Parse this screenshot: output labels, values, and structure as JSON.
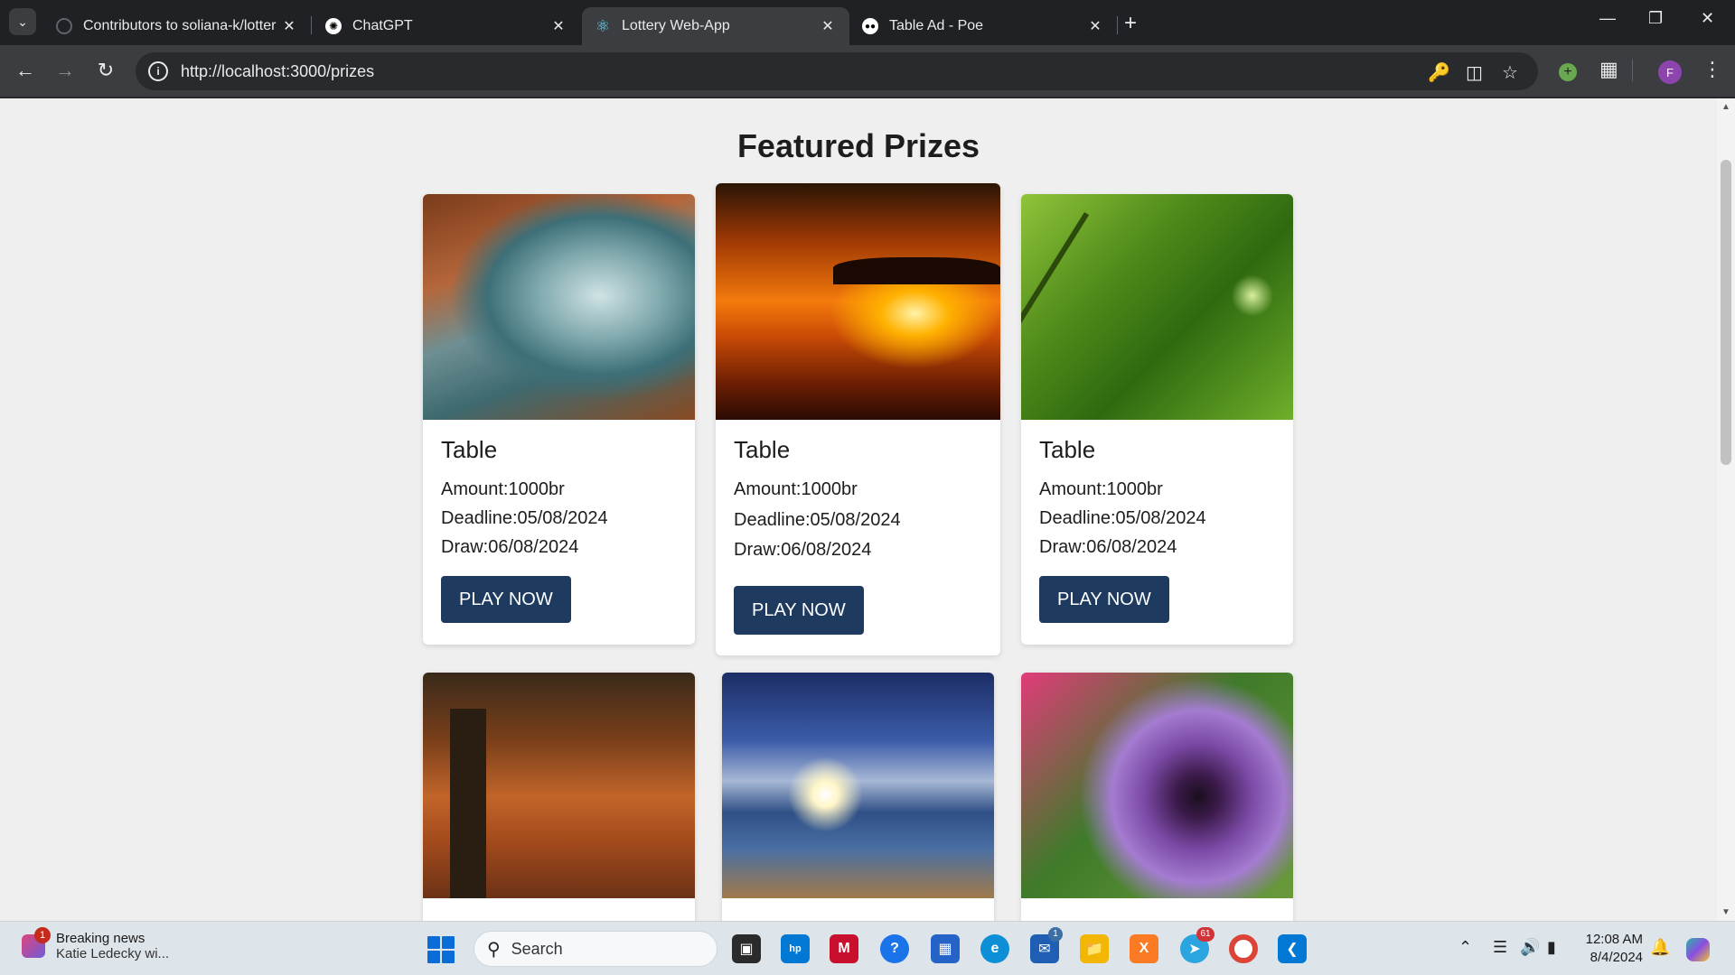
{
  "browser": {
    "tabs": [
      {
        "title": "Contributors to soliana-k/lotter",
        "active": false,
        "favicon": "github-icon"
      },
      {
        "title": "ChatGPT",
        "active": false,
        "favicon": "chatgpt-icon"
      },
      {
        "title": "Lottery Web-App",
        "active": true,
        "favicon": "react-icon"
      },
      {
        "title": "Table Ad - Poe",
        "active": false,
        "favicon": "poe-icon"
      }
    ],
    "url": "http://localhost:3000/prizes",
    "profile_initial": "F"
  },
  "page": {
    "title": "Featured Prizes",
    "cards": [
      {
        "name": "Table",
        "amount": "Amount:1000br",
        "deadline": "Deadline:05/08/2024",
        "draw": "Draw:06/08/2024",
        "button": "PLAY NOW",
        "image": "rocky-coast-mist"
      },
      {
        "name": "Table",
        "amount": "Amount:1000br",
        "deadline": "Deadline:05/08/2024",
        "draw": "Draw:06/08/2024",
        "button": "PLAY NOW",
        "image": "orange-sunset-lake"
      },
      {
        "name": "Table",
        "amount": "Amount:1000br",
        "deadline": "Deadline:05/08/2024",
        "draw": "Draw:06/08/2024",
        "button": "PLAY NOW",
        "image": "ants-on-grass"
      },
      {
        "image": "autumn-tree-path"
      },
      {
        "image": "tropical-sky-palm"
      },
      {
        "image": "purple-pansy-flowers"
      }
    ]
  },
  "taskbar": {
    "news_title": "Breaking news",
    "news_sub": "Katie Ledecky wi...",
    "news_badge": "1",
    "search_label": "Search",
    "mail_badge": "1",
    "telegram_badge": "61",
    "time": "12:08 AM",
    "date": "8/4/2024"
  }
}
